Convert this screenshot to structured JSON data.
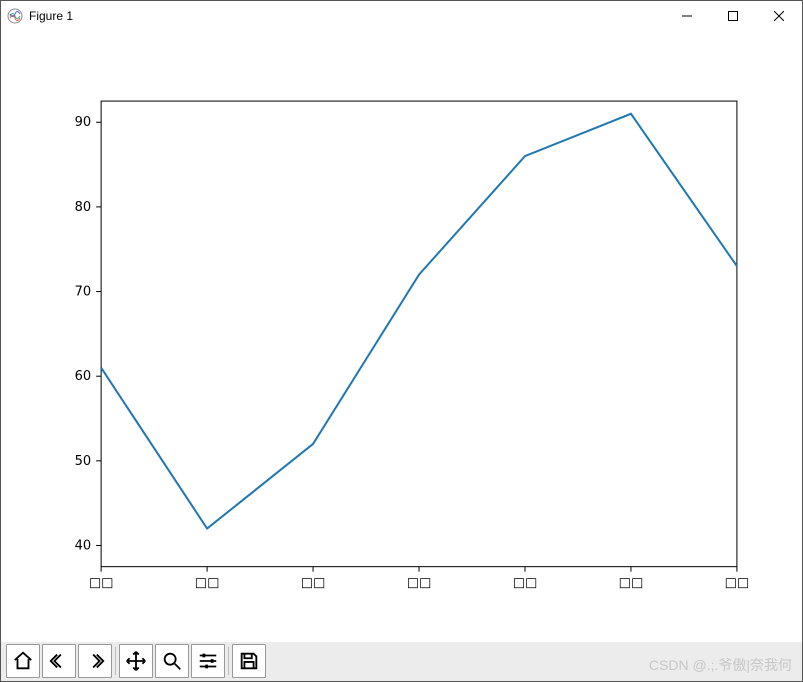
{
  "window": {
    "title": "Figure 1"
  },
  "toolbar": {
    "buttons": {
      "home": "Home",
      "back": "Back",
      "forward": "Forward",
      "pan": "Pan",
      "zoom": "Zoom",
      "configure": "Configure subplots",
      "save": "Save"
    }
  },
  "watermark": "CSDN @.;.爷傲|奈我何",
  "chart_data": {
    "type": "line",
    "categories": [
      "□□",
      "□□",
      "□□",
      "□□",
      "□□",
      "□□",
      "□□"
    ],
    "values": [
      61,
      42,
      52,
      72,
      86,
      91,
      73
    ],
    "title": "",
    "xlabel": "",
    "ylabel": "",
    "ylim": [
      40,
      90
    ],
    "yticks": [
      40,
      50,
      60,
      70,
      80,
      90
    ],
    "line_color": "#1f77b4"
  }
}
